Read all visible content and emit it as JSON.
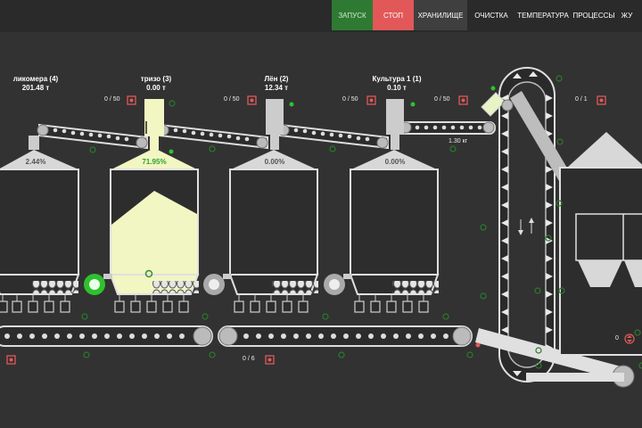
{
  "nav": {
    "start": "ЗАПУСК",
    "stop": "СТОП",
    "storage": "ХРАНИЛИЩЕ",
    "cleaning": "ОЧИСТКА",
    "temperature": "ТЕМПЕРАТУРА",
    "processes": "ПРОЦЕССЫ",
    "journal": "ЖУ"
  },
  "silos": [
    {
      "name": "ликомера (4)",
      "weight": "201.48 т",
      "fill": "2.44%",
      "counter": "0 / 50"
    },
    {
      "name": "тризо (3)",
      "weight": "0.00 т",
      "fill": "71.95%",
      "counter": "0 / 50"
    },
    {
      "name": "Лён (2)",
      "weight": "12.34 т",
      "fill": "0.00%",
      "counter": "0 / 50"
    },
    {
      "name": "Культура 1 (1)",
      "weight": "0.10 т",
      "fill": "0.00%",
      "counter": "0 / 50"
    }
  ],
  "conveyor_weight": "1.30 кг",
  "elevator_counter": "0 / 1",
  "bottom_counter": "0 / 6",
  "right_value": "0",
  "colors": {
    "active": "#f2f6c2",
    "steel": "#e2e2e2",
    "bg": "#323232",
    "green": "#2fc02f",
    "red": "#e25858"
  }
}
